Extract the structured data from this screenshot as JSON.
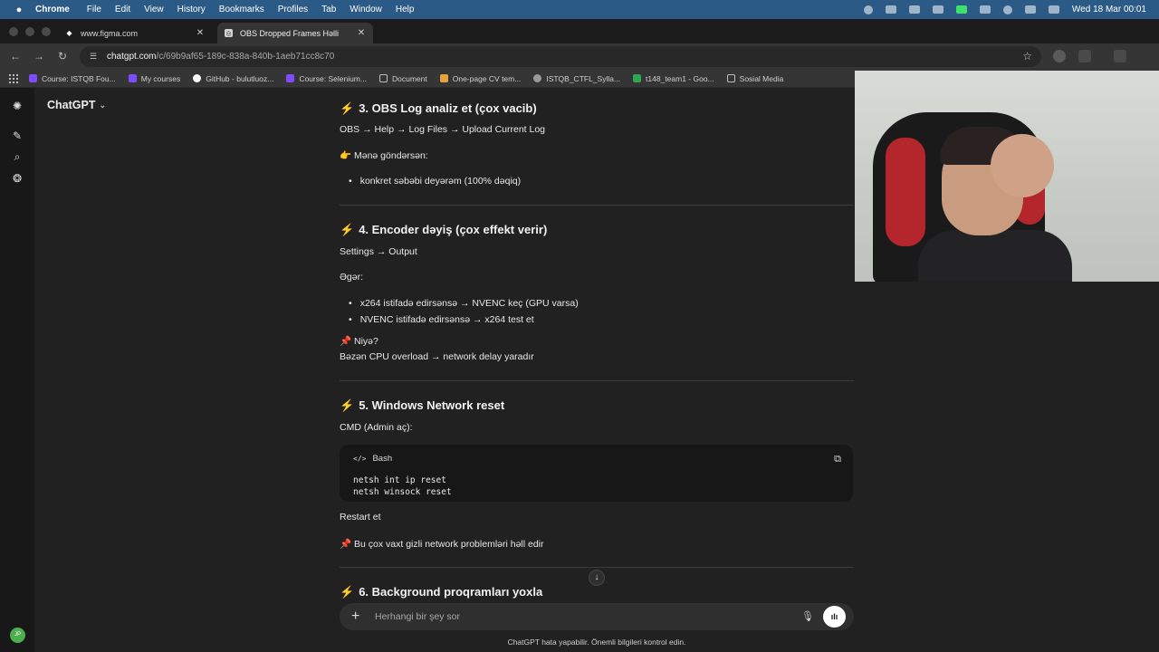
{
  "menubar": {
    "apple": "",
    "app": "Chrome",
    "items": [
      "File",
      "Edit",
      "View",
      "History",
      "Bookmarks",
      "Profiles",
      "Tab",
      "Window",
      "Help"
    ],
    "clock": "Wed 18 Mar  00:01"
  },
  "tabs": [
    {
      "label": "www.figma.com"
    },
    {
      "label": "OBS Dropped Frames Həlli"
    }
  ],
  "address": {
    "host": "chatgpt.com",
    "path": "/c/69b9af65-189c-838a-840b-1aeb71cc8c70"
  },
  "bookmarks": [
    {
      "label": "Course: ISTQB Fou...",
      "color": "#7c4dff"
    },
    {
      "label": "My courses",
      "color": "#7c4dff"
    },
    {
      "label": "GitHub - bulutluoz...",
      "color": "#ffffff"
    },
    {
      "label": "Course: Selenium...",
      "color": "#7c4dff"
    },
    {
      "label": "Document",
      "color": "#3a3a3a"
    },
    {
      "label": "One-page CV tem...",
      "color": "#e8a23b"
    },
    {
      "label": "ISTQB_CTFL_Sylla...",
      "color": "#9a9a9a"
    },
    {
      "label": "t148_team1 - Goo...",
      "color": "#2fa84f"
    },
    {
      "label": "Sosial Media",
      "color": "#3a3a3a"
    }
  ],
  "sidebar": {
    "avatar": "JP"
  },
  "model_picker": {
    "label": "ChatGPT"
  },
  "content": {
    "s3": {
      "heading": "3. OBS Log analiz et (çox vacib)",
      "path": "OBS → Help → Log Files → Upload Current Log",
      "send_emoji": "👉",
      "send": "Mənə göndərsən:",
      "bullet": "konkret səbəbi deyərəm (100% dəqiq)"
    },
    "s4": {
      "heading": "4. Encoder dəyiş (çox effekt verir)",
      "path": "Settings → Output",
      "if": "Əgər:",
      "bullets": [
        "x264 istifadə edirsənsə → NVENC keç (GPU varsa)",
        "NVENC istifadə edirsənsə → x264 test et"
      ],
      "why_emoji": "📌",
      "why": "Niyə?",
      "reason": "Bəzən CPU overload → network delay yaradır"
    },
    "s5": {
      "heading": "5. Windows Network reset",
      "cmd": "CMD (Admin aç):",
      "code_lang": "Bash",
      "code_lines": [
        "netsh int ip reset",
        "netsh winsock reset"
      ],
      "restart": "Restart et",
      "note_emoji": "📌",
      "note": "Bu çox vaxt gizli network problemləri həll edir"
    },
    "s6": {
      "heading": "6. Background proqramları yoxla"
    },
    "bolt": "⚡"
  },
  "composer": {
    "placeholder": "Herhangi bir şey sor"
  },
  "disclaimer": "ChatGPT hata yapabilir. Önemli bilgileri kontrol edin."
}
